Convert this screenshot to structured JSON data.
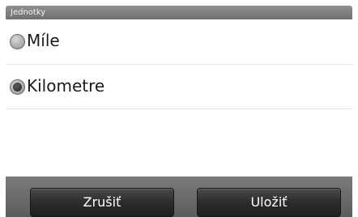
{
  "header": {
    "title": "Jednotky"
  },
  "options": [
    {
      "label": "Míle",
      "selected": false
    },
    {
      "label": "Kilometre",
      "selected": true
    }
  ],
  "footer": {
    "cancel_label": "Zrušiť",
    "save_label": "Uložiť"
  }
}
